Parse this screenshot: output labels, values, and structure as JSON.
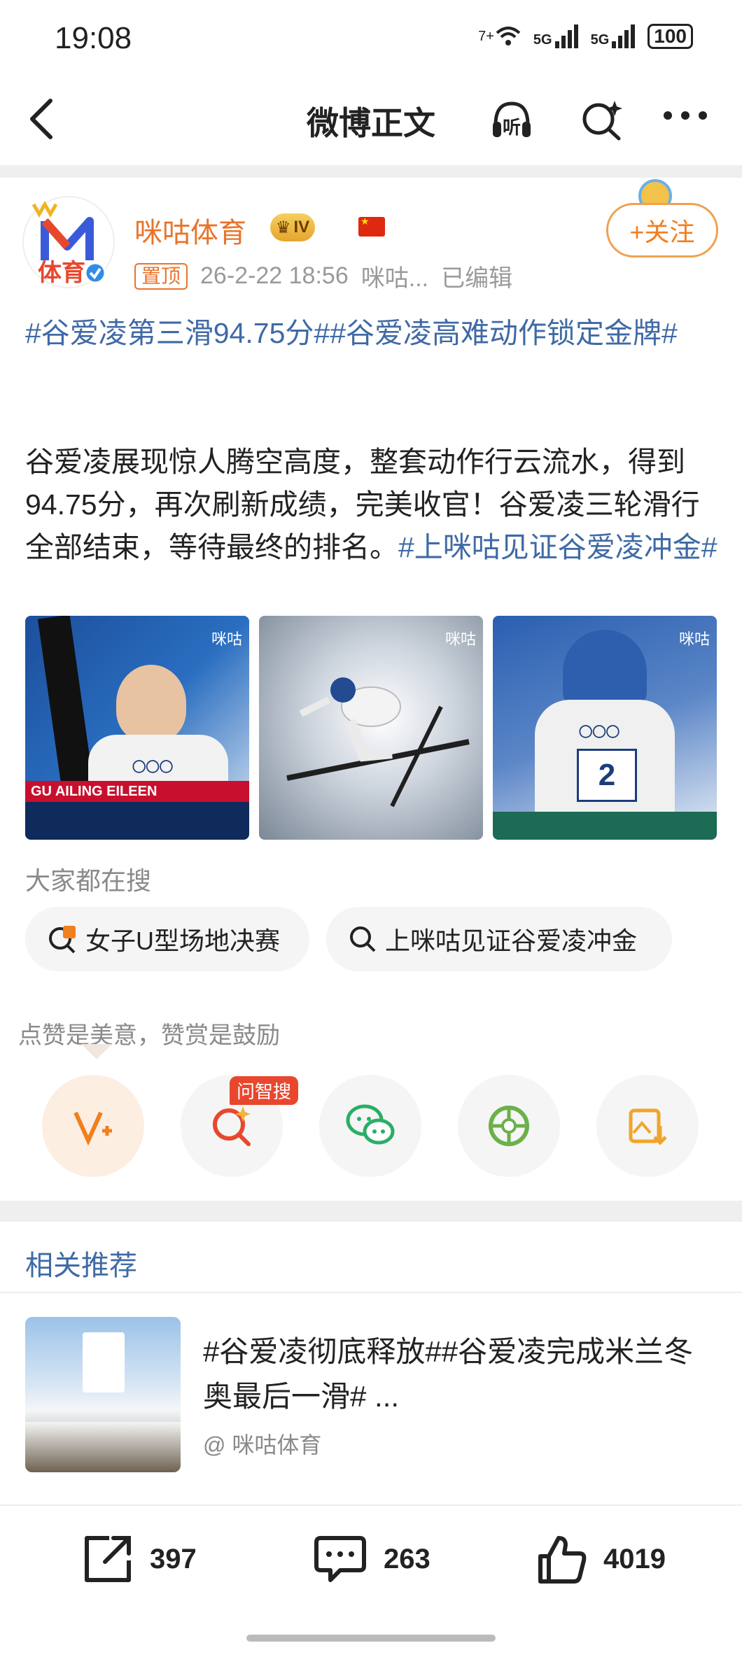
{
  "status_bar": {
    "time": "19:08",
    "network1": "5G",
    "network2": "5G",
    "wifi_tag": "7+",
    "battery": "100"
  },
  "nav": {
    "title": "微博正文",
    "listen_label": "听"
  },
  "post": {
    "author": "咪咕体育",
    "avatar_text": "体育",
    "level_badge": "IV",
    "pin_label": "置顶",
    "timestamp": "26-2-22 18:56",
    "source": "咪咕...",
    "edited": "已编辑",
    "follow_label": "+关注",
    "topic_line": "#谷爱凌第三滑94.75分##谷爱凌高难动作锁定金牌#",
    "body_text": "谷爱凌展现惊人腾空高度，整套动作行云流水，得到94.75分，再次刷新成绩，完美收官！谷爱凌三轮滑行全部结束，等待最终的排名。",
    "body_topic": "#上咪咕见证谷爱凌冲金#",
    "images": [
      {
        "watermark": "咪咕",
        "caption": "GU AILING EILEEN"
      },
      {
        "watermark": "咪咕"
      },
      {
        "watermark": "咪咕",
        "bib": "2"
      }
    ]
  },
  "search": {
    "label": "大家都在搜",
    "chips": [
      "女子U型场地决赛",
      "上咪咕见证谷爱凌冲金"
    ]
  },
  "actions_row": {
    "tip": "点赞是美意，赞赏是鼓励",
    "ai_tag": "问智搜"
  },
  "recommend": {
    "section_title": "相关推荐",
    "item_title": "#谷爱凌彻底释放##谷爱凌完成米兰冬奥最后一滑# ...",
    "item_source": "@ 咪咕体育"
  },
  "bottom": {
    "repost": "397",
    "comment": "263",
    "like": "4019"
  },
  "colors": {
    "accent": "#e8742b",
    "link": "#3f6aa6",
    "hot_red": "#e8472e"
  }
}
